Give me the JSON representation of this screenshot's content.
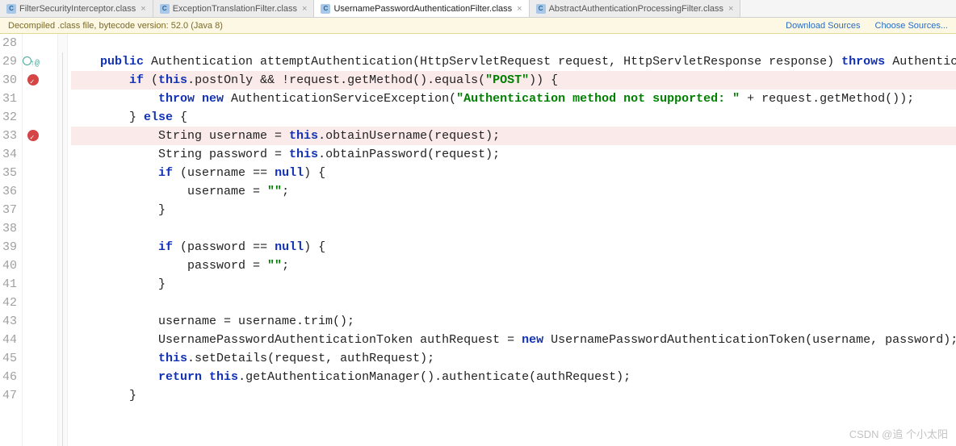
{
  "tabs": [
    {
      "label": "FilterSecurityInterceptor.class",
      "active": false
    },
    {
      "label": "ExceptionTranslationFilter.class",
      "active": false
    },
    {
      "label": "UsernamePasswordAuthenticationFilter.class",
      "active": true
    },
    {
      "label": "AbstractAuthenticationProcessingFilter.class",
      "active": false
    }
  ],
  "infobar": {
    "text": "Decompiled .class file, bytecode version: 52.0 (Java 8)",
    "links": {
      "download": "Download Sources",
      "choose": "Choose Sources..."
    }
  },
  "lines": {
    "start": 28,
    "rows": [
      {
        "n": 28,
        "html": ""
      },
      {
        "n": 29,
        "mark": "ov",
        "html": "    <span class='kw'>public</span> Authentication attemptAuthentication(HttpServletRequest request, HttpServletResponse response) <span class='kw'>throws</span> Authentica"
      },
      {
        "n": 30,
        "mark": "bp2",
        "hl": true,
        "html": "        <span class='kw'>if</span> (<span class='kw'>this</span>.postOnly && !request.getMethod().equals(<span class='str'>\"POST\"</span>)) {"
      },
      {
        "n": 31,
        "html": "            <span class='kw'>throw new</span> AuthenticationServiceException(<span class='str'>\"Authentication method not supported: \"</span> + request.getMethod());"
      },
      {
        "n": 32,
        "html": "        } <span class='kw'>else</span> {"
      },
      {
        "n": 33,
        "mark": "bp2",
        "hl": true,
        "html": "            String username = <span class='kw'>this</span>.obtainUsername(request);"
      },
      {
        "n": 34,
        "html": "            String password = <span class='kw'>this</span>.obtainPassword(request);"
      },
      {
        "n": 35,
        "html": "            <span class='kw'>if</span> (username == <span class='kw'>null</span>) {"
      },
      {
        "n": 36,
        "html": "                username = <span class='str'>\"\"</span>;"
      },
      {
        "n": 37,
        "html": "            }"
      },
      {
        "n": 38,
        "html": ""
      },
      {
        "n": 39,
        "html": "            <span class='kw'>if</span> (password == <span class='kw'>null</span>) {"
      },
      {
        "n": 40,
        "html": "                password = <span class='str'>\"\"</span>;"
      },
      {
        "n": 41,
        "html": "            }"
      },
      {
        "n": 42,
        "html": ""
      },
      {
        "n": 43,
        "html": "            username = username.trim();"
      },
      {
        "n": 44,
        "html": "            UsernamePasswordAuthenticationToken authRequest = <span class='kw'>new</span> UsernamePasswordAuthenticationToken(username, password);"
      },
      {
        "n": 45,
        "html": "            <span class='kw'>this</span>.setDetails(request, authRequest);"
      },
      {
        "n": 46,
        "html": "            <span class='kw'>return this</span>.getAuthenticationManager().authenticate(authRequest);"
      },
      {
        "n": 47,
        "html": "        }"
      }
    ]
  },
  "watermark": "CSDN @追    个小太阳"
}
